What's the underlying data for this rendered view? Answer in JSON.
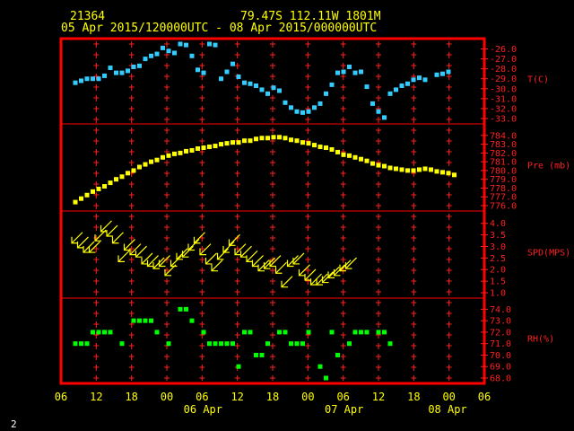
{
  "header": {
    "station": "21364",
    "location": "79.47S   112.11W   1801M",
    "period": "05 Apr 2015/120000UTC - 08 Apr 2015/000000UTC"
  },
  "page_number": "2",
  "colors": {
    "frame": "#ff0000",
    "grid": "#ff2020",
    "text": "#ffff00",
    "temperature": "#33ccff",
    "pressure": "#ffff00",
    "wind": "#ffff00",
    "rh": "#00ff00"
  },
  "chart_data": {
    "type": "scatter",
    "x_axis": {
      "tick_labels": [
        "06",
        "12",
        "18",
        "00",
        "06",
        "12",
        "18",
        "00",
        "06",
        "12",
        "18",
        "00",
        "06"
      ],
      "day_labels": [
        "06 Apr",
        "07 Apr",
        "08 Apr"
      ],
      "xlim_hours": [
        -6,
        66
      ],
      "x_unit": "hours from 05 Apr 2015 12 UTC"
    },
    "panels": [
      {
        "name": "T(C)",
        "type": "scatter",
        "ylim": [
          -33.0,
          -25.5
        ],
        "ticks": [
          -26.0,
          -27.0,
          -28.0,
          -29.0,
          -30.0,
          -31.0,
          -32.0,
          -33.0
        ],
        "points": [
          [
            0,
            -29.4
          ],
          [
            1,
            -29.2
          ],
          [
            2,
            -29.0
          ],
          [
            3,
            -29.0
          ],
          [
            4,
            -29.0
          ],
          [
            5,
            -28.7
          ],
          [
            6,
            -27.9
          ],
          [
            7,
            -28.4
          ],
          [
            8,
            -28.4
          ],
          [
            9,
            -28.2
          ],
          [
            10,
            -27.8
          ],
          [
            11,
            -27.7
          ],
          [
            12,
            -27.0
          ],
          [
            13,
            -26.7
          ],
          [
            14,
            -26.5
          ],
          [
            15,
            -25.9
          ],
          [
            16,
            -26.2
          ],
          [
            17,
            -26.4
          ],
          [
            18,
            -25.5
          ],
          [
            19,
            -25.6
          ],
          [
            20,
            -26.7
          ],
          [
            21,
            -28.1
          ],
          [
            22,
            -28.4
          ],
          [
            23,
            -25.5
          ],
          [
            24,
            -25.6
          ],
          [
            25,
            -29.0
          ],
          [
            26,
            -28.3
          ],
          [
            27,
            -27.5
          ],
          [
            28,
            -28.8
          ],
          [
            29,
            -29.4
          ],
          [
            30,
            -29.5
          ],
          [
            31,
            -29.7
          ],
          [
            32,
            -30.1
          ],
          [
            33,
            -30.5
          ],
          [
            34,
            -29.9
          ],
          [
            35,
            -30.2
          ],
          [
            36,
            -31.4
          ],
          [
            37,
            -31.9
          ],
          [
            38,
            -32.3
          ],
          [
            39,
            -32.4
          ],
          [
            40,
            -32.3
          ],
          [
            41,
            -31.9
          ],
          [
            42,
            -31.5
          ],
          [
            43,
            -30.5
          ],
          [
            44,
            -29.6
          ],
          [
            45,
            -28.4
          ],
          [
            46,
            -28.3
          ],
          [
            47,
            -27.8
          ],
          [
            48,
            -28.4
          ],
          [
            49,
            -28.3
          ],
          [
            50,
            -29.8
          ],
          [
            51,
            -31.5
          ],
          [
            52,
            -32.3
          ],
          [
            53,
            -32.9
          ],
          [
            54,
            -30.5
          ],
          [
            55,
            -30.1
          ],
          [
            56,
            -29.7
          ],
          [
            57,
            -29.5
          ],
          [
            58,
            -29.1
          ],
          [
            59,
            -28.9
          ],
          [
            60,
            -29.1
          ],
          [
            62,
            -28.6
          ],
          [
            63,
            -28.5
          ],
          [
            64,
            -28.3
          ]
        ]
      },
      {
        "name": "Pre (mb)",
        "type": "scatter",
        "ylim": [
          776.0,
          784.7
        ],
        "ticks": [
          784.0,
          783.0,
          782.0,
          781.0,
          780.0,
          779.0,
          778.0,
          777.0,
          776.0
        ],
        "points": [
          [
            0,
            776.4
          ],
          [
            1,
            776.8
          ],
          [
            2,
            777.2
          ],
          [
            3,
            777.6
          ],
          [
            4,
            777.9
          ],
          [
            5,
            778.2
          ],
          [
            6,
            778.6
          ],
          [
            7,
            779.0
          ],
          [
            8,
            779.3
          ],
          [
            9,
            779.7
          ],
          [
            10,
            780.0
          ],
          [
            11,
            780.4
          ],
          [
            12,
            780.7
          ],
          [
            13,
            781.0
          ],
          [
            14,
            781.2
          ],
          [
            15,
            781.5
          ],
          [
            16,
            781.7
          ],
          [
            17,
            781.9
          ],
          [
            18,
            782.0
          ],
          [
            19,
            782.2
          ],
          [
            20,
            782.3
          ],
          [
            21,
            782.5
          ],
          [
            22,
            782.6
          ],
          [
            23,
            782.7
          ],
          [
            24,
            782.8
          ],
          [
            25,
            783.0
          ],
          [
            26,
            783.1
          ],
          [
            27,
            783.2
          ],
          [
            28,
            783.2
          ],
          [
            29,
            783.4
          ],
          [
            30,
            783.4
          ],
          [
            31,
            783.6
          ],
          [
            32,
            783.7
          ],
          [
            33,
            783.7
          ],
          [
            34,
            783.8
          ],
          [
            35,
            783.8
          ],
          [
            36,
            783.7
          ],
          [
            37,
            783.5
          ],
          [
            38,
            783.4
          ],
          [
            39,
            783.2
          ],
          [
            40,
            783.1
          ],
          [
            41,
            782.9
          ],
          [
            42,
            782.7
          ],
          [
            43,
            782.6
          ],
          [
            44,
            782.4
          ],
          [
            45,
            782.1
          ],
          [
            46,
            781.8
          ],
          [
            47,
            781.7
          ],
          [
            48,
            781.5
          ],
          [
            49,
            781.3
          ],
          [
            50,
            781.1
          ],
          [
            51,
            780.8
          ],
          [
            52,
            780.6
          ],
          [
            53,
            780.5
          ],
          [
            54,
            780.3
          ],
          [
            55,
            780.2
          ],
          [
            56,
            780.1
          ],
          [
            57,
            780.0
          ],
          [
            58,
            780.0
          ],
          [
            59,
            780.1
          ],
          [
            60,
            780.2
          ],
          [
            61,
            780.1
          ],
          [
            62,
            779.9
          ],
          [
            63,
            779.8
          ],
          [
            64,
            779.7
          ],
          [
            65,
            779.5
          ]
        ]
      },
      {
        "name": "SPD(MPS)",
        "type": "scatter",
        "ylim": [
          1.0,
          4.3
        ],
        "ticks": [
          4.0,
          3.5,
          3.0,
          2.5,
          2.0,
          1.5,
          1.0
        ],
        "points": [
          [
            0,
            3.3
          ],
          [
            1,
            3.1
          ],
          [
            2,
            2.9
          ],
          [
            3,
            2.9
          ],
          [
            4,
            3.4
          ],
          [
            5,
            3.8
          ],
          [
            6,
            3.6
          ],
          [
            7,
            3.3
          ],
          [
            8,
            2.5
          ],
          [
            9,
            3.0
          ],
          [
            10,
            2.8
          ],
          [
            11,
            2.7
          ],
          [
            12,
            2.4
          ],
          [
            13,
            2.3
          ],
          [
            14,
            2.2
          ],
          [
            15,
            2.3
          ],
          [
            16,
            1.9
          ],
          [
            17,
            2.3
          ],
          [
            18,
            2.6
          ],
          [
            19,
            2.7
          ],
          [
            20,
            3.0
          ],
          [
            21,
            3.3
          ],
          [
            22,
            2.8
          ],
          [
            23,
            2.4
          ],
          [
            24,
            2.1
          ],
          [
            25,
            2.6
          ],
          [
            26,
            2.9
          ],
          [
            27,
            3.2
          ],
          [
            28,
            2.8
          ],
          [
            29,
            2.7
          ],
          [
            30,
            2.5
          ],
          [
            31,
            2.3
          ],
          [
            32,
            2.1
          ],
          [
            33,
            2.2
          ],
          [
            34,
            2.3
          ],
          [
            35,
            2.0
          ],
          [
            36,
            1.4
          ],
          [
            37,
            2.3
          ],
          [
            38,
            2.4
          ],
          [
            39,
            1.9
          ],
          [
            40,
            1.7
          ],
          [
            41,
            1.5
          ],
          [
            42,
            1.5
          ],
          [
            43,
            1.6
          ],
          [
            44,
            1.8
          ],
          [
            45,
            1.9
          ],
          [
            46,
            2.1
          ],
          [
            47,
            2.2
          ]
        ]
      },
      {
        "name": "RH(%)",
        "type": "scatter",
        "ylim": [
          68.0,
          74.5
        ],
        "ticks": [
          74.0,
          73.0,
          72.0,
          71.0,
          70.0,
          69.0,
          68.0
        ],
        "points": [
          [
            0,
            71.0
          ],
          [
            1,
            71.0
          ],
          [
            2,
            71.0
          ],
          [
            3,
            72.0
          ],
          [
            4,
            72.0
          ],
          [
            5,
            72.0
          ],
          [
            6,
            72.0
          ],
          [
            8,
            71.0
          ],
          [
            10,
            73.0
          ],
          [
            11,
            73.0
          ],
          [
            12,
            73.0
          ],
          [
            13,
            73.0
          ],
          [
            14,
            72.0
          ],
          [
            16,
            71.0
          ],
          [
            18,
            74.0
          ],
          [
            19,
            74.0
          ],
          [
            20,
            73.0
          ],
          [
            22,
            72.0
          ],
          [
            23,
            71.0
          ],
          [
            24,
            71.0
          ],
          [
            25,
            71.0
          ],
          [
            26,
            71.0
          ],
          [
            27,
            71.0
          ],
          [
            28,
            69.0
          ],
          [
            29,
            72.0
          ],
          [
            30,
            72.0
          ],
          [
            31,
            70.0
          ],
          [
            32,
            70.0
          ],
          [
            33,
            71.0
          ],
          [
            35,
            72.0
          ],
          [
            36,
            72.0
          ],
          [
            37,
            71.0
          ],
          [
            38,
            71.0
          ],
          [
            39,
            71.0
          ],
          [
            40,
            72.0
          ],
          [
            42,
            69.0
          ],
          [
            43,
            68.0
          ],
          [
            44,
            72.0
          ],
          [
            45,
            70.0
          ],
          [
            47,
            71.0
          ],
          [
            48,
            72.0
          ],
          [
            49,
            72.0
          ],
          [
            50,
            72.0
          ],
          [
            52,
            72.0
          ],
          [
            53,
            72.0
          ],
          [
            54,
            71.0
          ]
        ]
      }
    ]
  }
}
